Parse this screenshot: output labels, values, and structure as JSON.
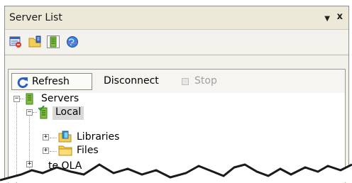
{
  "panel": {
    "title": "Server List",
    "pin_glyph": "▼",
    "close_glyph": "x"
  },
  "toolbar_icons": [
    {
      "name": "server-properties-icon"
    },
    {
      "name": "folder-icon"
    },
    {
      "name": "server-tower-icon"
    },
    {
      "name": "globe-icon"
    }
  ],
  "commands": {
    "refresh_label": "Refresh",
    "disconnect_label": "Disconnect",
    "stop_label": "Stop"
  },
  "tree": {
    "root": {
      "label": "Servers",
      "expander": "−"
    },
    "local": {
      "label": "Local",
      "expander": "−"
    },
    "libraries": {
      "label": "Libraries",
      "expander": "+"
    },
    "files": {
      "label": "Files",
      "expander": "+"
    },
    "partial": {
      "label": "te OLA",
      "expander": "+"
    }
  },
  "colors": {
    "panel_bg": "#f2f1ea",
    "titlebar_bg": "#ece9d8",
    "selection_bg": "#d9d9d9",
    "folder_yellow": "#f6cd54",
    "server_green": "#7fbf3f",
    "refresh_blue": "#2a5fc9"
  }
}
